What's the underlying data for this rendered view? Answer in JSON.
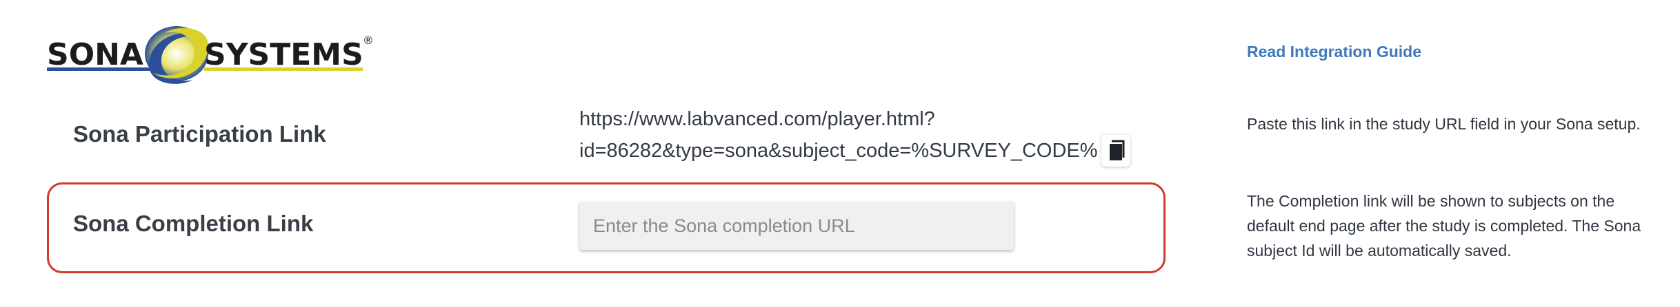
{
  "logo": {
    "text_left": "SONA",
    "text_right": "SYSTEMS",
    "registered": "®"
  },
  "guide_link": "Read Integration Guide",
  "participation": {
    "label": "Sona Participation Link",
    "url_line1": "https://www.labvanced.com/player.html?",
    "url_line2": "id=86282&type=sona&subject_code=%SURVEY_CODE%",
    "copy_icon": "copy-icon",
    "help": "Paste this link in the study URL field in your Sona setup."
  },
  "completion": {
    "label": "Sona Completion Link",
    "value": "",
    "placeholder": "Enter the Sona completion URL",
    "help": "The Completion link will be shown to subjects on the default end page after the study is completed. The Sona subject Id will be automatically saved."
  },
  "colors": {
    "highlight": "#d33a2c",
    "link": "#3f78bd",
    "logo_blue": "#2b4f9a",
    "logo_yellow": "#d8d22a"
  }
}
